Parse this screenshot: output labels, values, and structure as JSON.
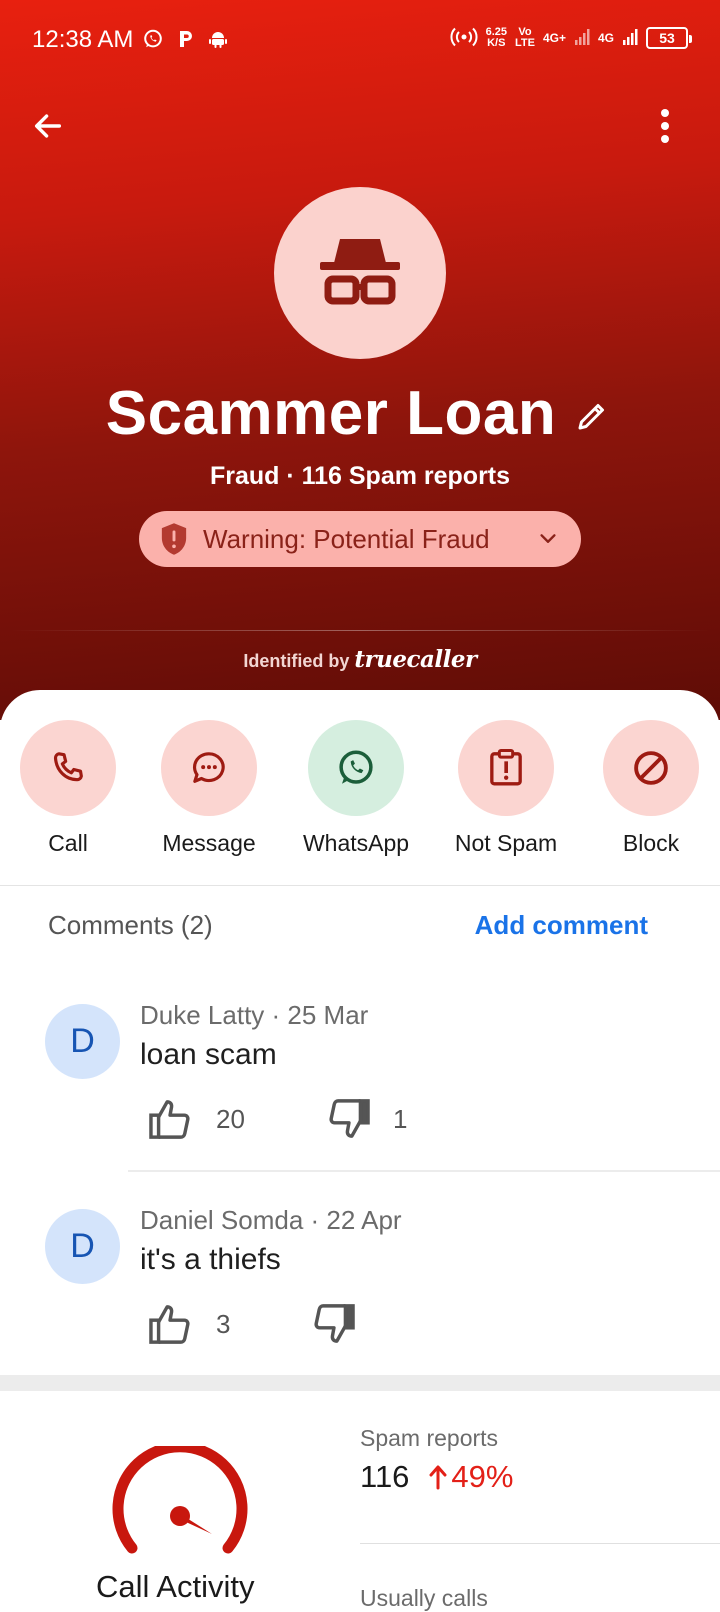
{
  "status_bar": {
    "time": "12:38 AM",
    "net_speed": "6.25",
    "net_unit": "K/S",
    "volte_top": "Vo",
    "volte_bottom": "LTE",
    "sim1": "4G+",
    "sim2": "4G",
    "battery": "53"
  },
  "header": {
    "contact_name": "Scammer Loan",
    "subtitle": "Fraud · 116 Spam reports",
    "warning": "Warning: Potential Fraud",
    "identified_prefix": "Identified by",
    "identified_brand": "truecaller"
  },
  "actions": [
    {
      "label": "Call",
      "icon": "phone-icon"
    },
    {
      "label": "Message",
      "icon": "message-icon"
    },
    {
      "label": "WhatsApp",
      "icon": "whatsapp-icon"
    },
    {
      "label": "Not Spam",
      "icon": "not-spam-icon"
    },
    {
      "label": "Block",
      "icon": "block-icon"
    }
  ],
  "comments": {
    "title": "Comments (2)",
    "add_label": "Add comment",
    "items": [
      {
        "initial": "D",
        "author_date": "Duke Latty · 25 Mar",
        "text": "loan scam",
        "likes": "20",
        "dislikes": "1"
      },
      {
        "initial": "D",
        "author_date": "Daniel Somda · 22 Apr",
        "text": "it's a thiefs",
        "likes": "3",
        "dislikes": ""
      }
    ]
  },
  "activity": {
    "title": "Call Activity",
    "spam_label": "Spam reports",
    "spam_value": "116",
    "spam_change": "49%",
    "usually_label": "Usually calls"
  },
  "colors": {
    "hero_top": "#e8200f",
    "hero_bottom": "#5e0c06",
    "accent_red": "#e32018",
    "link_blue": "#1a73e8",
    "action_bg": "#fbd5d1",
    "whatsapp_bg": "#d5eedf"
  }
}
